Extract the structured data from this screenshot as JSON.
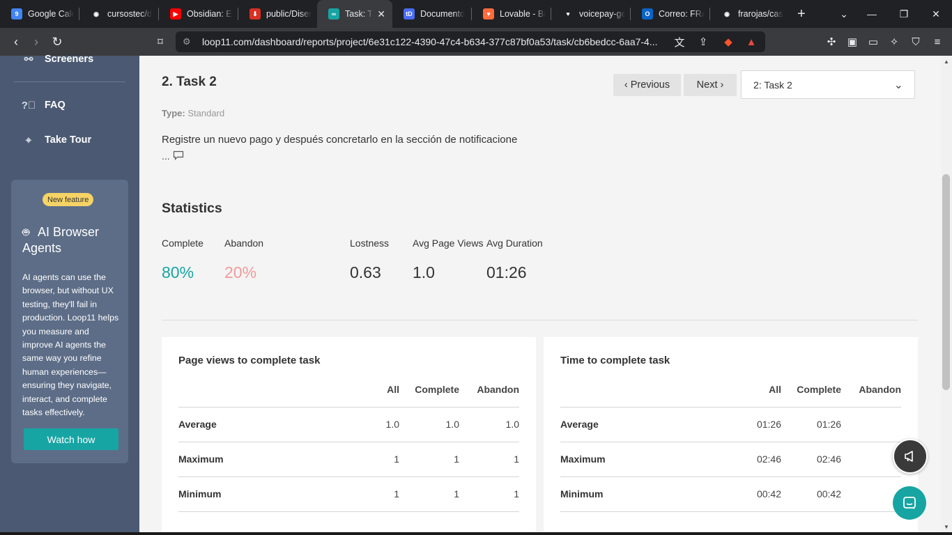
{
  "browser": {
    "tabs": [
      {
        "label": "Google Cale",
        "icon": "google-calendar-icon",
        "color": "#4285f4",
        "glyph": "9"
      },
      {
        "label": "cursostec/d",
        "icon": "github-icon",
        "color": "#ffffff",
        "glyph": "◉"
      },
      {
        "label": "Obsidian: El",
        "icon": "youtube-icon",
        "color": "#ff0000",
        "glyph": "▶"
      },
      {
        "label": "public/Diser",
        "icon": "pdf-icon",
        "color": "#d93025",
        "glyph": "⬇"
      },
      {
        "label": "Task: Ta",
        "icon": "loop11-icon",
        "color": "#17a5a3",
        "glyph": "∞",
        "active": true
      },
      {
        "label": "Documento",
        "icon": "td-icon",
        "color": "#4a6cf7",
        "glyph": "tD"
      },
      {
        "label": "Lovable - Bu",
        "icon": "heart-icon",
        "color": "#ff6b3d",
        "glyph": "♥"
      },
      {
        "label": "voicepay-ge",
        "icon": "voicepay-heart-icon",
        "color": "#ffffff",
        "glyph": "♥"
      },
      {
        "label": "Correo: FRA",
        "icon": "outlook-icon",
        "color": "#0a64c8",
        "glyph": "O"
      },
      {
        "label": "frarojas/cas",
        "icon": "github-icon",
        "color": "#ffffff",
        "glyph": "◉"
      }
    ],
    "url": "loop11.com/dashboard/reports/project/6e31c122-4390-47c4-b634-377c87bf0a53/task/cb6bedcc-6aa7-4..."
  },
  "sidebar": {
    "items": [
      {
        "label": "Screeners",
        "icon": "screeners-icon"
      },
      {
        "label": "FAQ",
        "icon": "question-icon"
      },
      {
        "label": "Take Tour",
        "icon": "location-pin-icon"
      }
    ],
    "promo": {
      "badge": "New feature",
      "title": "AI Browser Agents",
      "body": "AI agents can use the browser, but without UX testing, they'll fail in production. Loop11 helps you measure and improve AI agents the same way you refine human experiences—ensuring they navigate, interact, and complete tasks effectively.",
      "button": "Watch how"
    }
  },
  "task": {
    "title": "2. Task 2",
    "type_label": "Type:",
    "type_value": "Standard",
    "description": "Registre un nuevo pago y después concretarlo en la sección de notificacione",
    "ellipsis": "...",
    "prev_label": "Previous",
    "next_label": "Next",
    "selected_task": "2: Task 2"
  },
  "statistics": {
    "title": "Statistics",
    "items": [
      {
        "label": "Complete",
        "value": "80%",
        "color": "#17a5a3"
      },
      {
        "label": "Abandon",
        "value": "20%",
        "color": "#f29a9a"
      },
      {
        "label": "Lostness",
        "value": "0.63",
        "color": "#333333"
      },
      {
        "label": "Avg Page Views",
        "value": "1.0",
        "color": "#333333"
      },
      {
        "label": "Avg Duration",
        "value": "01:26",
        "color": "#333333"
      }
    ]
  },
  "page_views_card": {
    "title": "Page views to complete task",
    "columns": [
      "All",
      "Complete",
      "Abandon"
    ],
    "rows": [
      {
        "label": "Average",
        "values": [
          "1.0",
          "1.0",
          "1.0"
        ]
      },
      {
        "label": "Maximum",
        "values": [
          "1",
          "1",
          "1"
        ]
      },
      {
        "label": "Minimum",
        "values": [
          "1",
          "1",
          "1"
        ]
      }
    ]
  },
  "time_card": {
    "title": "Time to complete task",
    "columns": [
      "All",
      "Complete",
      "Abandon"
    ],
    "rows": [
      {
        "label": "Average",
        "values": [
          "01:26",
          "01:26",
          ""
        ]
      },
      {
        "label": "Maximum",
        "values": [
          "02:46",
          "02:46",
          ""
        ]
      },
      {
        "label": "Minimum",
        "values": [
          "00:42",
          "00:42",
          ""
        ]
      }
    ]
  }
}
